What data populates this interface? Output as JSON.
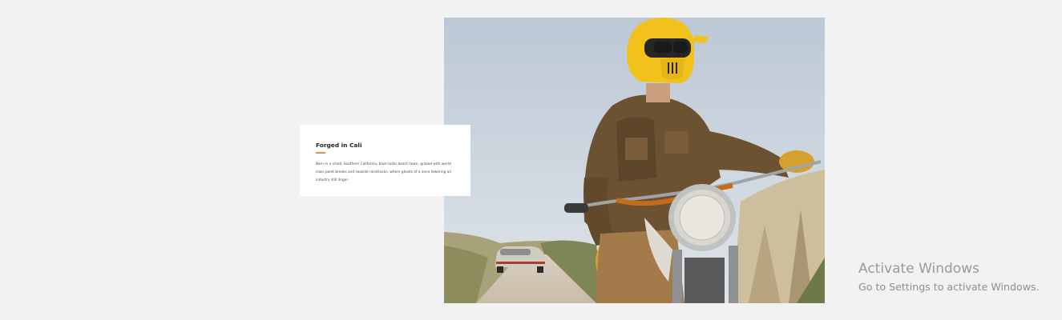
{
  "feature": {
    "image_alt": "Rider in yellow helmet and brown jacket on a vintage motorcycle on a coastal road, classic car behind",
    "title": "Forged in Cali",
    "body": "Born in a small, Southern California, blue-collar beach town, grazed with world class point breaks and seaside racetracks, where ghosts of a once towering oil industry still linger."
  },
  "colors": {
    "page_background": "#f2f2f2",
    "card_background": "#ffffff",
    "accent": "#d39a3a",
    "helmet": "#f0c21b"
  },
  "watermark": {
    "title": "Activate Windows",
    "subtitle": "Go to Settings to activate Windows."
  }
}
